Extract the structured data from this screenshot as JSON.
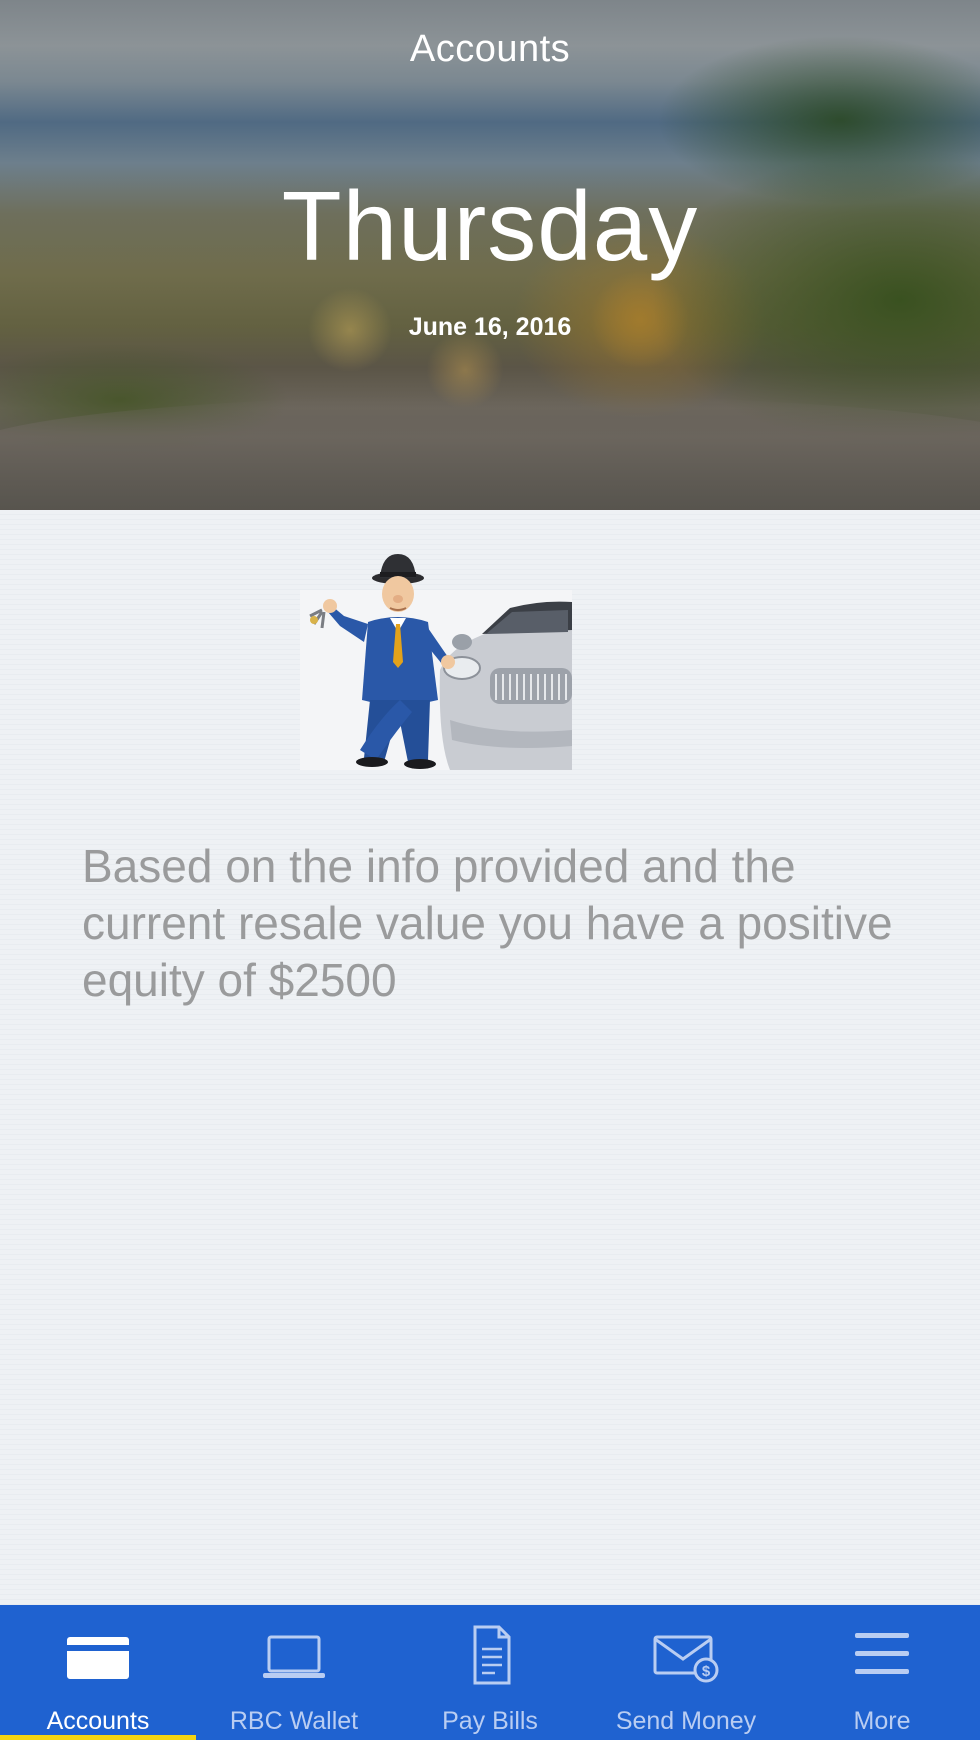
{
  "header": {
    "title": "Accounts",
    "day": "Thursday",
    "date": "June 16, 2016"
  },
  "main": {
    "message": "Based on the info provided and the current resale value you have a positive equity of $2500",
    "illustration_icon": "banker-with-car-illustration"
  },
  "tabbar": {
    "tabs": [
      {
        "label": "Accounts",
        "icon": "card-icon",
        "active": true
      },
      {
        "label": "RBC Wallet",
        "icon": "laptop-icon",
        "active": false
      },
      {
        "label": "Pay Bills",
        "icon": "document-icon",
        "active": false
      },
      {
        "label": "Send Money",
        "icon": "envelope-dollar-icon",
        "active": false
      },
      {
        "label": "More",
        "icon": "menu-icon",
        "active": false
      }
    ]
  },
  "colors": {
    "tabbar_bg": "#1f62d0",
    "active_indicator": "#f5d410",
    "message_text": "#9a9b9c",
    "content_bg": "#eef1f4"
  }
}
